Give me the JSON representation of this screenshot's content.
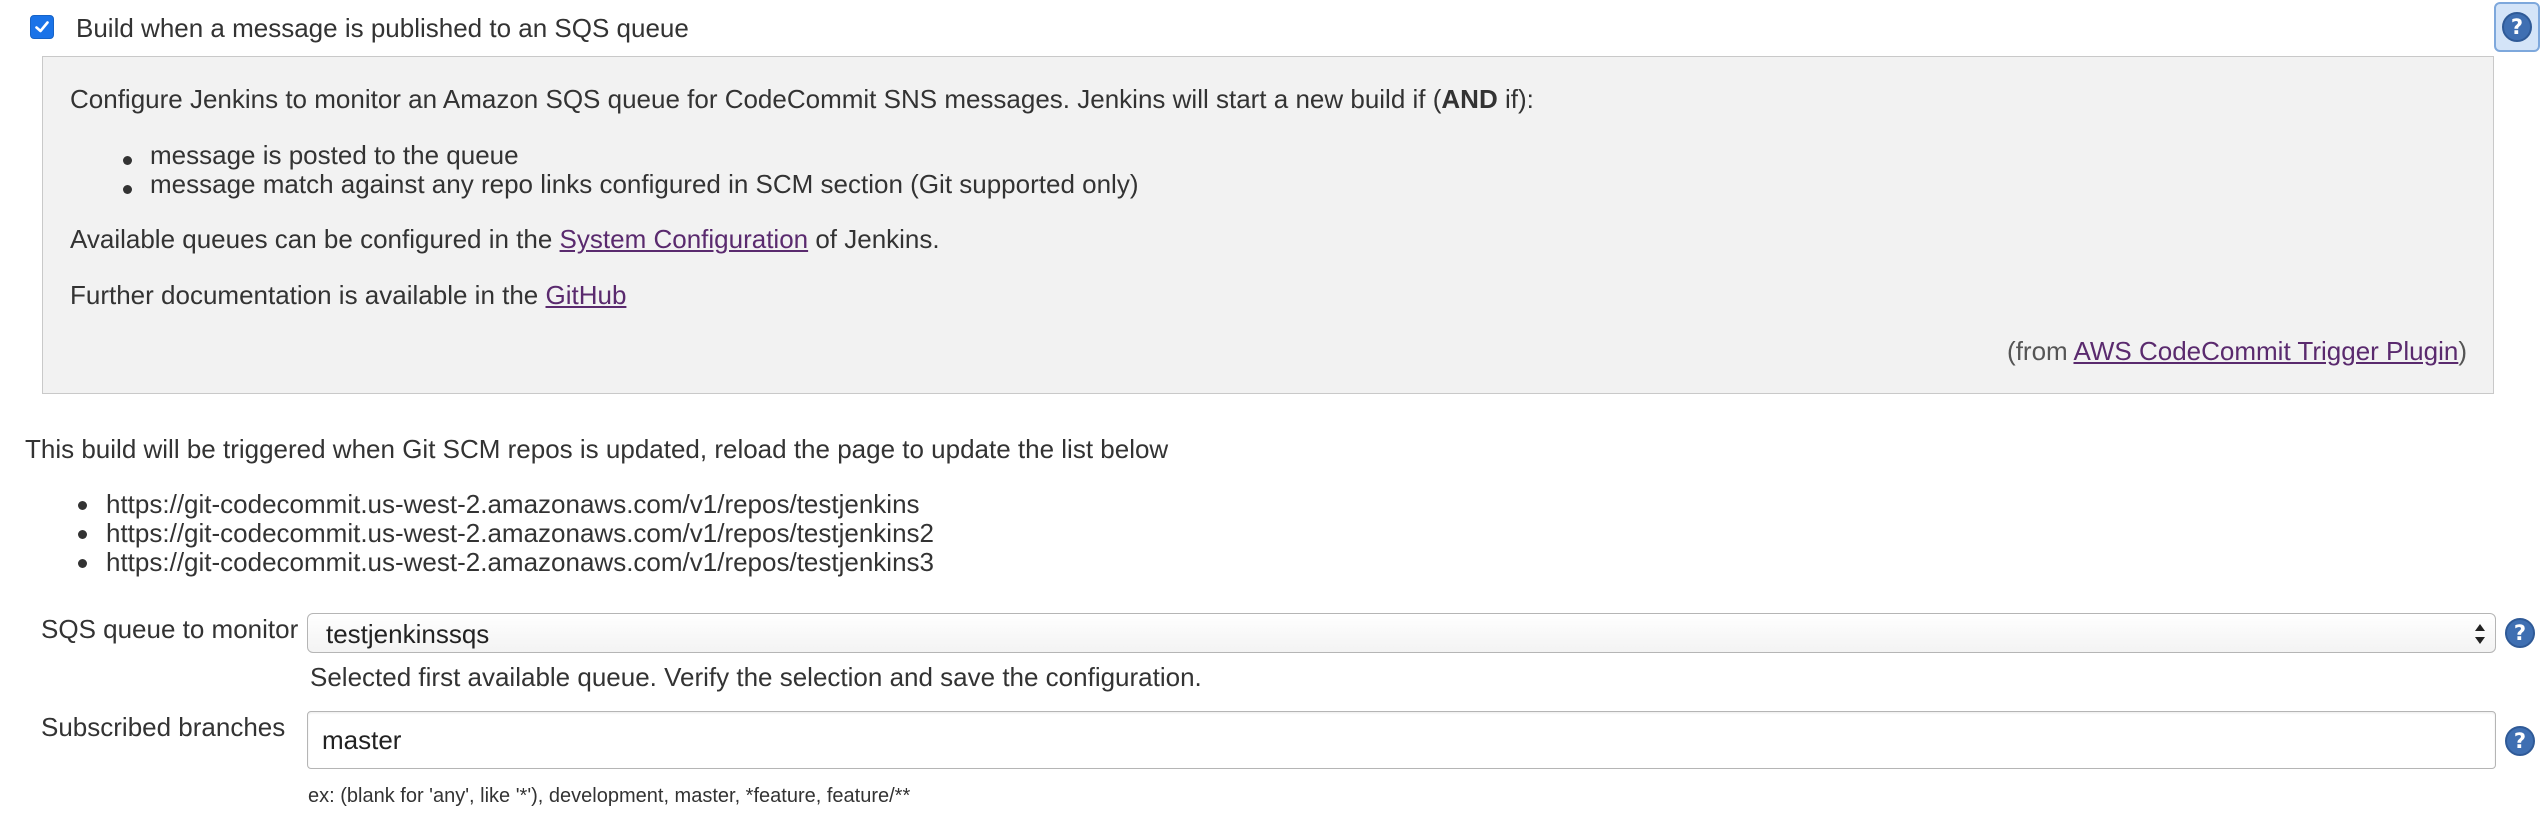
{
  "trigger": {
    "checked": true,
    "label": "Build when a message is published to an SQS queue"
  },
  "help_box": {
    "intro_before": "Configure Jenkins to monitor an Amazon SQS queue for CodeCommit SNS messages. Jenkins will start a new build if (",
    "intro_bold": "AND",
    "intro_after": " if):",
    "conditions": [
      "message is posted to the queue",
      "message match against any repo links configured in SCM section (Git supported only)"
    ],
    "queues_before": "Available queues can be configured in the ",
    "queues_link": "System Configuration",
    "queues_after": " of Jenkins.",
    "docs_before": "Further documentation is available in the ",
    "docs_link": "GitHub",
    "from_before": "(from ",
    "from_link": "AWS CodeCommit Trigger Plugin",
    "from_after": ")"
  },
  "repos": {
    "heading": "This build will be triggered when Git SCM repos is updated, reload the page to update the list below",
    "items": [
      "https://git-codecommit.us-west-2.amazonaws.com/v1/repos/testjenkins",
      "https://git-codecommit.us-west-2.amazonaws.com/v1/repos/testjenkins2",
      "https://git-codecommit.us-west-2.amazonaws.com/v1/repos/testjenkins3"
    ]
  },
  "queue_field": {
    "label": "SQS queue to monitor",
    "value": "testjenkinssqs",
    "note": "Selected first available queue. Verify the selection and save the configuration."
  },
  "branches_field": {
    "label": "Subscribed branches",
    "value": "master",
    "hint": "ex: (blank for 'any', like '*'), development, master, *feature, feature/**"
  },
  "icons": {
    "help": "question-mark-help-icon",
    "checkbox": "checkmark-icon",
    "select": "chevron-up-down-icon"
  },
  "colors": {
    "link": "#5a2a6e",
    "checkbox": "#1a73e8",
    "help_icon": "#3f6fb2",
    "help_box_bg": "#f2f2f2"
  }
}
